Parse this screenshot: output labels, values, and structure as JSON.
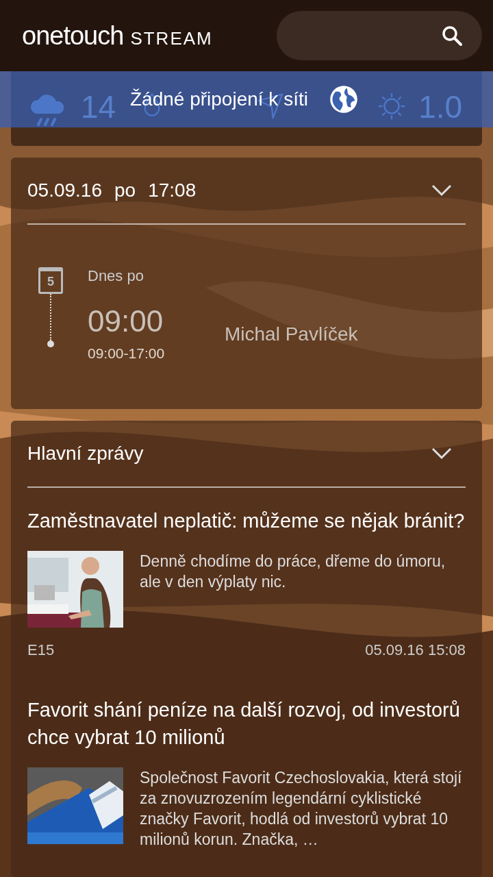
{
  "header": {
    "logo": "onetouch",
    "logo_suffix": "STREAM"
  },
  "offline_banner": {
    "text": "Žádné připojení k síti"
  },
  "weather": {
    "temperature": "14",
    "uv": "1.0"
  },
  "calendar_card": {
    "date": "05.09.16",
    "weekday": "po",
    "time": "17:08",
    "day_icon": "5",
    "day_label": "Dnes  po",
    "event_time": "09:00",
    "event_range": "09:00-17:00",
    "event_title": "Michal Pavlíček"
  },
  "news_card": {
    "title": "Hlavní zprávy",
    "articles": [
      {
        "headline": "Zaměstnavatel neplatič: můžeme se nějak bránit?",
        "summary": "Denně chodíme do práce, dřeme do úmoru, ale v den výplaty nic.",
        "source": "E15",
        "time": "05.09.16 15:08",
        "kind": "picture"
      },
      {
        "headline": "Favorit shání peníze na další rozvoj, od investorů chce vybrat 10 milionů",
        "summary": "Společnost Favorit Czechoslovakia, která stojí za znovuzrozením legendární cyklistické značky Favorit, hodlá od investorů vybrat 10 milionů korun. Značka, …",
        "kind": "picture"
      }
    ]
  }
}
